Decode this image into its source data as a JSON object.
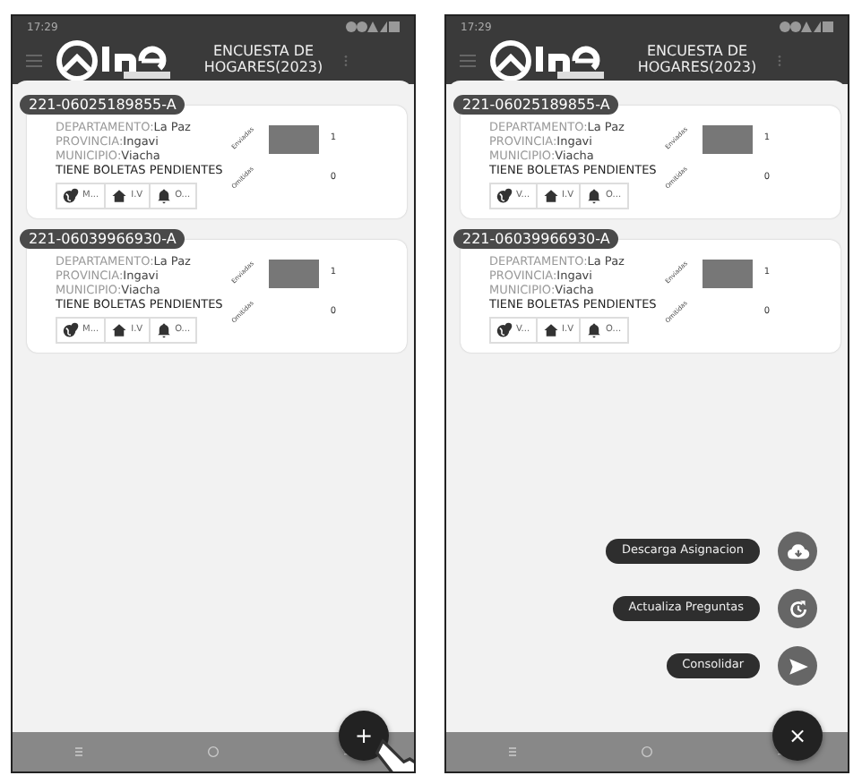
{
  "screens": [
    {
      "status_time": "17:29",
      "app_title": "ENCUESTA DE HOGARES(2023)",
      "cards": [
        {
          "code": "221-06025189855-A",
          "lines": [
            {
              "label": "DEPARTAMENTO:",
              "value": "La Paz"
            },
            {
              "label": "PROVINCIA:",
              "value": "Ingavi"
            },
            {
              "label": "MUNICIPIO:",
              "value": "Viacha"
            }
          ],
          "pending": "TIENE BOLETAS PENDIENTES",
          "actions": [
            {
              "kind": "globe",
              "label": "M..."
            },
            {
              "kind": "house",
              "label": "I.V"
            },
            {
              "kind": "bell",
              "label": "O..."
            }
          ],
          "counts": [
            {
              "label": "Enviadas",
              "value": "1"
            },
            {
              "label": "Omitidas",
              "value": "0"
            }
          ]
        },
        {
          "code": "221-06039966930-A",
          "lines": [
            {
              "label": "DEPARTAMENTO:",
              "value": "La Paz"
            },
            {
              "label": "PROVINCIA:",
              "value": "Ingavi"
            },
            {
              "label": "MUNICIPIO:",
              "value": "Viacha"
            }
          ],
          "pending": "TIENE BOLETAS PENDIENTES",
          "actions": [
            {
              "kind": "globe",
              "label": "M..."
            },
            {
              "kind": "house",
              "label": "I.V"
            },
            {
              "kind": "bell",
              "label": "O..."
            }
          ],
          "counts": [
            {
              "label": "Enviadas",
              "value": "1"
            },
            {
              "label": "Omitidas",
              "value": "0"
            }
          ]
        }
      ],
      "fab": "+",
      "expanded": false
    },
    {
      "status_time": "17:29",
      "app_title": "ENCUESTA DE HOGARES(2023)",
      "cards": [
        {
          "code": "221-06025189855-A",
          "lines": [
            {
              "label": "DEPARTAMENTO:",
              "value": "La Paz"
            },
            {
              "label": "PROVINCIA:",
              "value": "Ingavi"
            },
            {
              "label": "MUNICIPIO:",
              "value": "Viacha"
            }
          ],
          "pending": "TIENE BOLETAS PENDIENTES",
          "actions": [
            {
              "kind": "globe",
              "label": "V..."
            },
            {
              "kind": "house",
              "label": "I.V"
            },
            {
              "kind": "bell",
              "label": "O..."
            }
          ],
          "counts": [
            {
              "label": "Enviadas",
              "value": "1"
            },
            {
              "label": "Omitidas",
              "value": "0"
            }
          ]
        },
        {
          "code": "221-06039966930-A",
          "lines": [
            {
              "label": "DEPARTAMENTO:",
              "value": "La Paz"
            },
            {
              "label": "PROVINCIA:",
              "value": "Ingavi"
            },
            {
              "label": "MUNICIPIO:",
              "value": "Viacha"
            }
          ],
          "pending": "TIENE BOLETAS PENDIENTES",
          "actions": [
            {
              "kind": "globe",
              "label": "V..."
            },
            {
              "kind": "house",
              "label": "I.V"
            },
            {
              "kind": "bell",
              "label": "O..."
            }
          ],
          "counts": [
            {
              "label": "Enviadas",
              "value": "1"
            },
            {
              "label": "Omitidas",
              "value": "0"
            }
          ]
        }
      ],
      "fab": "×",
      "expanded": true,
      "menu": [
        {
          "label": "Descarga Asignacion",
          "kind": "cloud"
        },
        {
          "label": "Actualiza Preguntas",
          "kind": "refresh"
        },
        {
          "label": "Consolidar",
          "kind": "send"
        }
      ]
    }
  ]
}
